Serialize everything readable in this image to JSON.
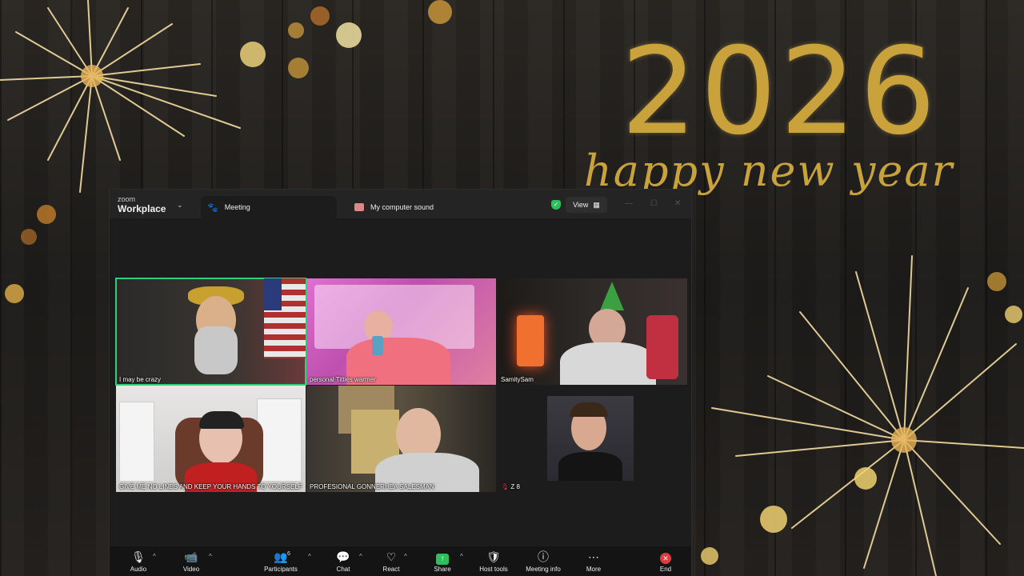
{
  "wallpaper": {
    "year": "2026",
    "greeting": "happy new year",
    "accent_color": "#c9a23c"
  },
  "window": {
    "logo_small": "zoom",
    "logo_main": "Workplace",
    "tabs": [
      {
        "label": "Meeting",
        "icon": "paw-icon"
      },
      {
        "label": "My computer sound",
        "icon": "speaker-icon"
      }
    ],
    "view_label": "View",
    "security_color": "#2ac05a"
  },
  "participants": [
    {
      "name": "I may be crazy",
      "active": true
    },
    {
      "name": "personal Titties warmer",
      "active": false
    },
    {
      "name": "SamitySam",
      "active": false
    },
    {
      "name": "GIVE ME NO LINES AND KEEP YOUR HANDS TO YOURSELF",
      "active": false
    },
    {
      "name": "PROFESIONAL GONNERHEA SALESMAN",
      "active": false
    },
    {
      "name": "Z 8",
      "active": false,
      "muted": true
    }
  ],
  "toolbar": {
    "audio": "Audio",
    "video": "Video",
    "participants": "Participants",
    "participants_count": "6",
    "chat": "Chat",
    "react": "React",
    "share": "Share",
    "host_tools": "Host tools",
    "meeting_info": "Meeting info",
    "more": "More",
    "end": "End"
  }
}
